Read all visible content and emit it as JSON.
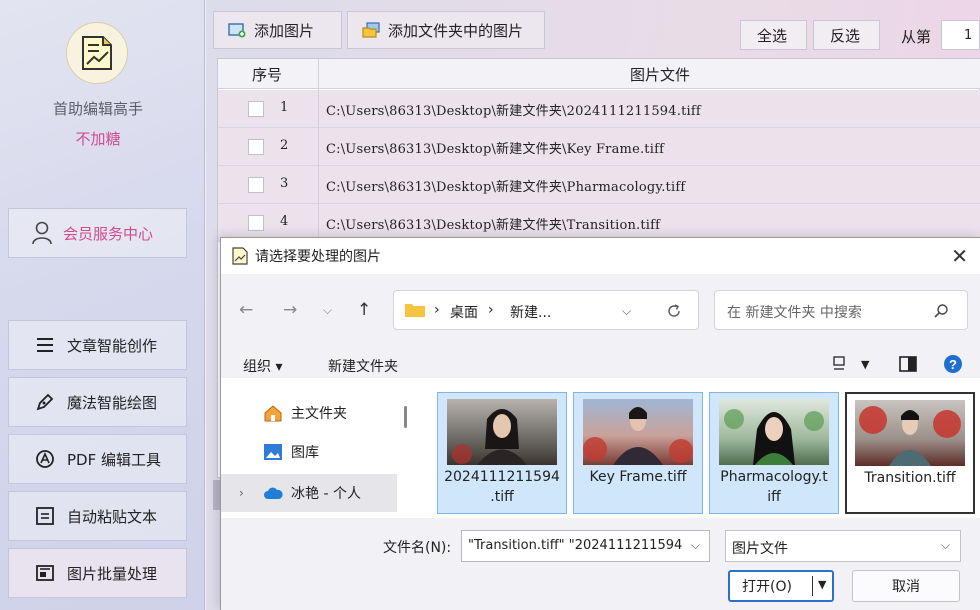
{
  "sidebar": {
    "app_name": "首助编辑高手",
    "subtitle": "不加糖",
    "member_label": "会员服务中心",
    "nav": [
      {
        "label": "文章智能创作",
        "icon": "list-icon"
      },
      {
        "label": "魔法智能绘图",
        "icon": "pen-icon"
      },
      {
        "label": "PDF 编辑工具",
        "icon": "pdf-icon"
      },
      {
        "label": "自动粘贴文本",
        "icon": "paste-icon"
      },
      {
        "label": "图片批量处理",
        "icon": "image-icon"
      }
    ]
  },
  "toolbar": {
    "add_image": "添加图片",
    "add_folder": "添加文件夹中的图片",
    "select_all": "全选",
    "invert": "反选",
    "from_label": "从第",
    "from_value": "1"
  },
  "table": {
    "headers": [
      "序号",
      "图片文件"
    ],
    "rows": [
      {
        "num": "1",
        "path": "C:\\Users\\86313\\Desktop\\新建文件夹\\2024111211594.tiff"
      },
      {
        "num": "2",
        "path": "C:\\Users\\86313\\Desktop\\新建文件夹\\Key Frame.tiff"
      },
      {
        "num": "3",
        "path": "C:\\Users\\86313\\Desktop\\新建文件夹\\Pharmacology.tiff"
      },
      {
        "num": "4",
        "path": "C:\\Users\\86313\\Desktop\\新建文件夹\\Transition.tiff"
      }
    ]
  },
  "dialog": {
    "title": "请选择要处理的图片",
    "address": {
      "seg1": "桌面",
      "seg2": "新建..."
    },
    "search_placeholder": "在 新建文件夹 中搜索",
    "organize": "组织 ▾",
    "new_folder": "新建文件夹",
    "tree": [
      {
        "label": "主文件夹",
        "icon": "home-icon"
      },
      {
        "label": "图库",
        "icon": "gallery-icon"
      },
      {
        "label": "冰艳 - 个人",
        "icon": "cloud-icon",
        "selected": true
      }
    ],
    "files": [
      {
        "name": "2024111211594.tiff",
        "name_line1": "2024111211594",
        "name_line2": ".tiff"
      },
      {
        "name": "Key Frame.tiff",
        "name_line1": "Key Frame.tiff",
        "name_line2": ""
      },
      {
        "name": "Pharmacology.tiff",
        "name_line1": "Pharmacology.t",
        "name_line2": "iff"
      },
      {
        "name": "Transition.tiff",
        "name_line1": "Transition.tiff",
        "name_line2": ""
      }
    ],
    "filename_label": "文件名(N):",
    "filename_value": "\"Transition.tiff\" \"2024111211594",
    "filetype": "图片文件",
    "open": "打开(O)",
    "cancel": "取消"
  },
  "colors": {
    "accent_pink": "#d14b8f",
    "selection_blue": "#cfe6fb",
    "primary_blue": "#2a72c9"
  }
}
